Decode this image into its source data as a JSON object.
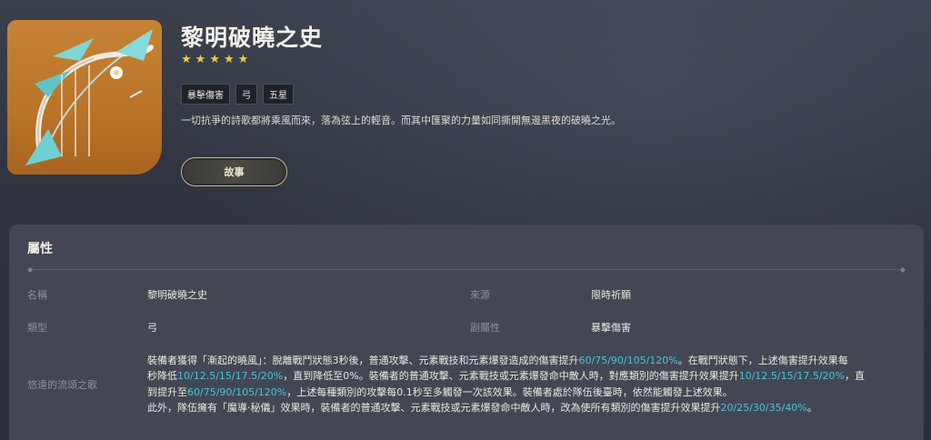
{
  "weapon": {
    "name": "黎明破曉之史",
    "stars": 5,
    "tags": [
      "暴擊傷害",
      "弓",
      "五星"
    ],
    "description": "一切抗爭的詩歌都將乘風而來，落為弦上的輕音。而其中匯聚的力量如同撕開無邊黑夜的破曉之光。",
    "story_button": "故事"
  },
  "colors": {
    "accent": "#4fc3d6",
    "star": "#f0c84a",
    "art_bg": "#c78335"
  },
  "attributes": {
    "heading": "屬性",
    "name_label": "名稱",
    "name_value": "黎明破曉之史",
    "source_label": "來源",
    "source_value": "限時祈願",
    "type_label": "類型",
    "type_value": "弓",
    "substat_label": "副屬性",
    "substat_value": "暴擊傷害",
    "passive_label": "悠遠的流頌之歌",
    "passive": {
      "l1a": "裝備者獲得「漸起的曉風」：脫離戰鬥狀態3秒後，普通攻擊、元素戰技和元素爆發造成的傷害提升",
      "l1b": "60/75/90/105/120%",
      "l1c": "。在戰鬥狀態下，上述傷害提升效果每",
      "l2a": "秒降低",
      "l2b": "10/12.5/15/17.5/20%",
      "l2c": "，直到降低至0%。裝備者的普通攻擊、元素戰技或元素爆發命中敵人時，對應類別的傷害提升效果提升",
      "l2d": "10/12.5/15/17.5/20%",
      "l2e": "，直",
      "l3a": "到提升至",
      "l3b": "60/75/90/105/120%",
      "l3c": "，上述每種類別的攻擊每0.1秒至多觸發一次該效果。裝備者處於隊伍後臺時，依然能觸發上述效果。",
      "l4a": "此外，隊伍擁有「魔導·秘儀」效果時，裝備者的普通攻擊、元素戰技或元素爆發命中敵人時，改為使所有類別的傷害提升效果提升",
      "l4b": "20/25/30/35/40%",
      "l4c": "。"
    }
  }
}
